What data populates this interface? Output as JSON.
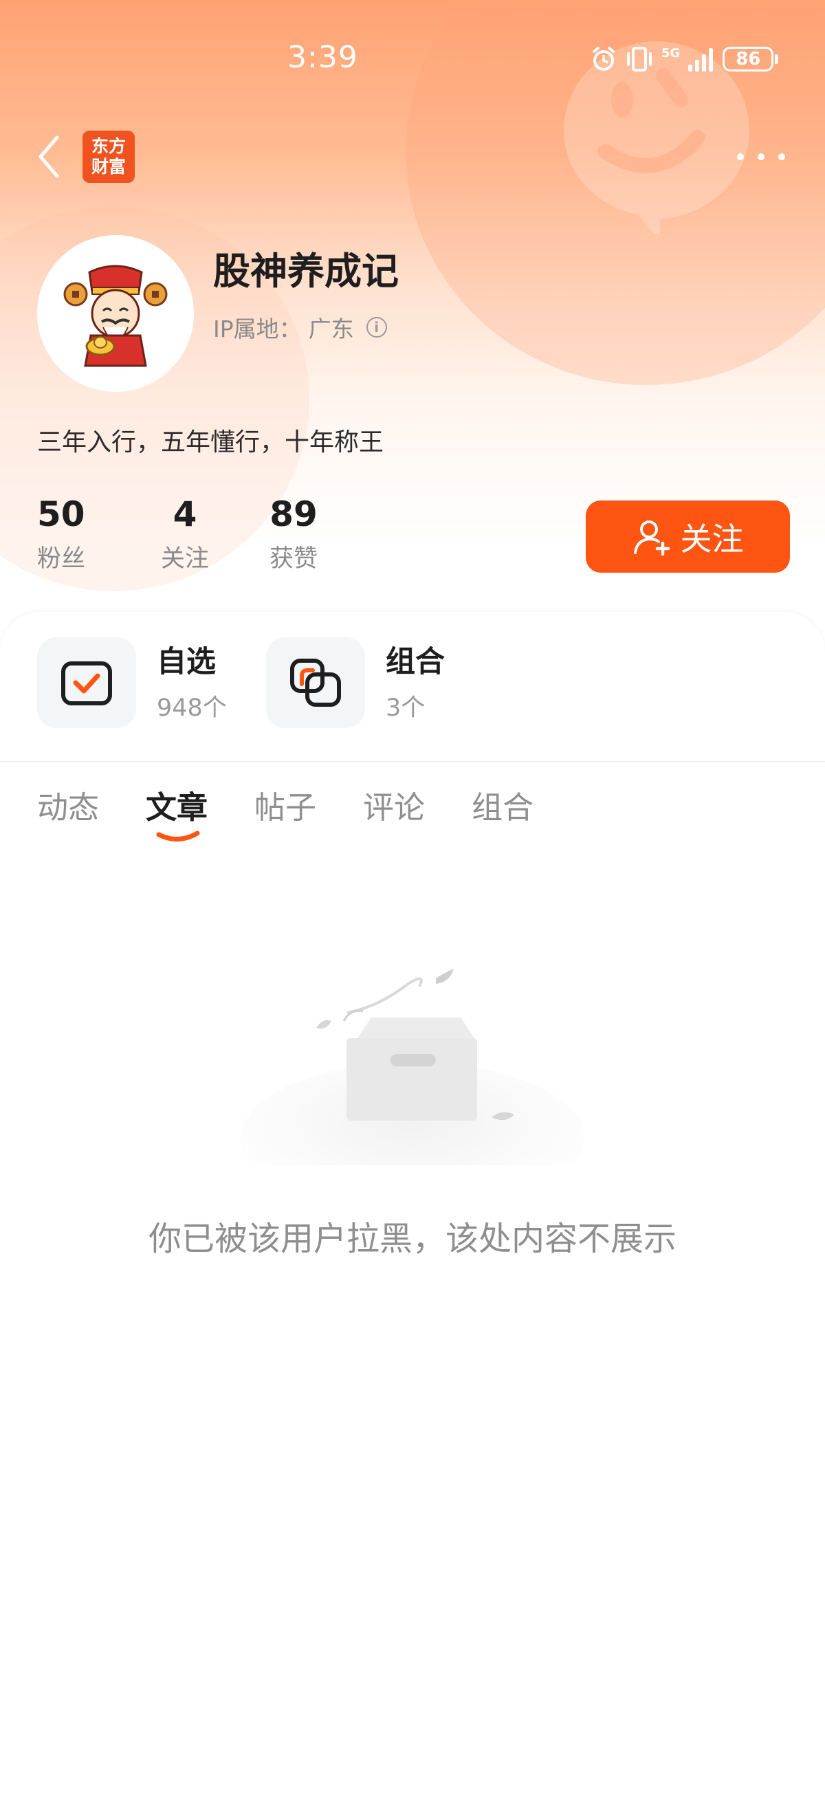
{
  "status_bar": {
    "time": "3:39",
    "network": "5G",
    "battery": "86",
    "icons": [
      "alarm-icon",
      "vibrate-icon",
      "signal-icon",
      "battery-icon"
    ]
  },
  "nav": {
    "back_icon": "chevron-left-icon",
    "logo_line1": "东方",
    "logo_line2": "财富",
    "more_icon": "more-dots-icon"
  },
  "profile": {
    "username": "股神养成记",
    "ip_label": "IP属地：",
    "ip_location": "广东",
    "bio": "三年入行，五年懂行，十年称王"
  },
  "stats": [
    {
      "value": "50",
      "label": "粉丝"
    },
    {
      "value": "4",
      "label": "关注"
    },
    {
      "value": "89",
      "label": "获赞"
    }
  ],
  "follow_button": {
    "label": "关注"
  },
  "tools": [
    {
      "title": "自选",
      "count": "948个"
    },
    {
      "title": "组合",
      "count": "3个"
    }
  ],
  "tabs": [
    {
      "label": "动态",
      "active": false
    },
    {
      "label": "文章",
      "active": true
    },
    {
      "label": "帖子",
      "active": false
    },
    {
      "label": "评论",
      "active": false
    },
    {
      "label": "组合",
      "active": false
    }
  ],
  "empty_state": {
    "message": "你已被该用户拉黑，该处内容不展示"
  },
  "colors": {
    "accent": "#ff5512",
    "header_gradient_top": "#ffa273"
  }
}
